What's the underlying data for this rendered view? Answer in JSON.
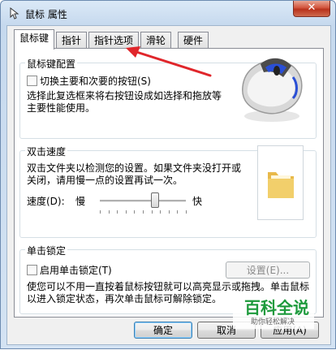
{
  "window": {
    "title": "鼠标 属性",
    "close_glyph": "✕"
  },
  "tabs": [
    {
      "label": "鼠标键"
    },
    {
      "label": "指针"
    },
    {
      "label": "指针选项"
    },
    {
      "label": "滑轮"
    },
    {
      "label": "硬件"
    }
  ],
  "button_config": {
    "group_label": "鼠标键配置",
    "switch_label": "切换主要和次要的按钮(S)",
    "switch_checked": false,
    "description": "选择此复选框来将右按钮设成如选择和拖放等主要性能使用。"
  },
  "double_click": {
    "group_label": "双击速度",
    "description": "双击文件夹以检测您的设置。如果文件夹没打开或关闭，请用慢一点的设置再试一次。",
    "speed_label": "速度(D):",
    "slow_label": "慢",
    "fast_label": "快",
    "speed_value": 0.64
  },
  "click_lock": {
    "group_label": "单击锁定",
    "enable_label": "启用单击锁定(T)",
    "enable_checked": false,
    "settings_label": "设置(E)...",
    "description": "使您可以不用一直按着鼠标按钮就可以高亮显示或拖拽。单击鼠标以进入锁定状态，再次单击鼠标可解除锁定。"
  },
  "footer": {
    "ok_label": "确定",
    "cancel_label": "取消",
    "apply_label": "应用(A)"
  },
  "watermark": {
    "title": "百科全说",
    "subtitle": "助你轻松解决"
  },
  "colors": {
    "arrow": "#e0262b",
    "accent_blue": "#2a4fd6",
    "folder": "#f2cf6b"
  }
}
